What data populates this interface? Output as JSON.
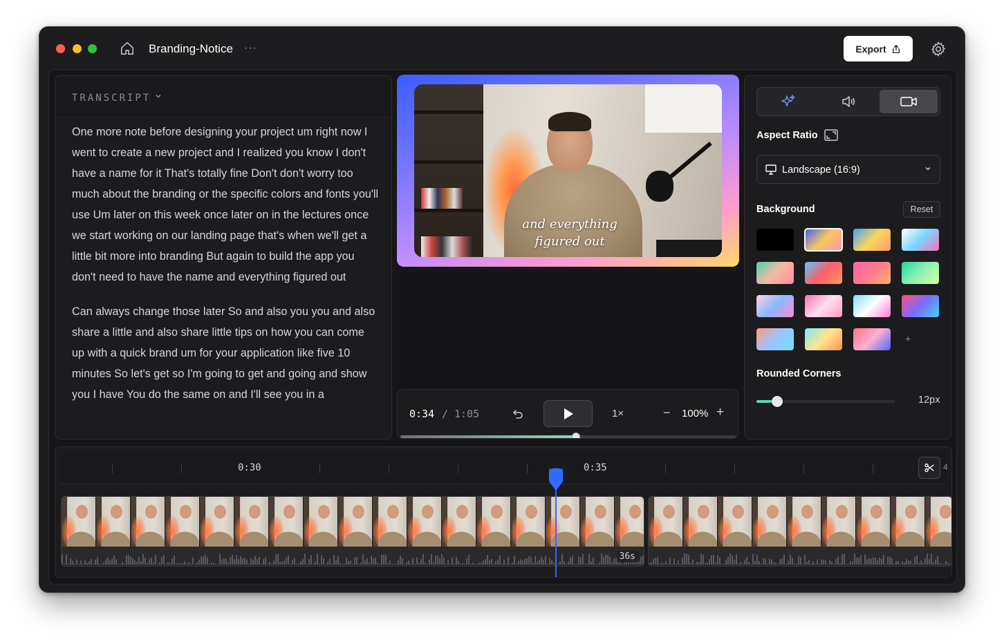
{
  "window": {
    "project_title": "Branding-Notice",
    "more_label": "···",
    "export_label": "Export"
  },
  "transcript": {
    "header": "TRANSCRIPT",
    "paragraphs": [
      "One more note before designing your project um right now I went to create a new project and I realized you know I don't have a name for it That's totally fine Don't don't worry too much about the branding or the specific colors and fonts you'll use Um later on this week once later on in the lectures once we start working on our landing page that's when we'll get a little bit more into branding But again to build the app you don't need to have the name and everything figured out",
      "Can always change those later So and also you you and also share a little and also share little tips on how you can come up with a quick brand um for your application like five 10 minutes So let's get so I'm going to get and going and show you I have You do the same on and I'll see you in a"
    ]
  },
  "preview": {
    "caption_line1": "and everything",
    "caption_line2": "figured out"
  },
  "player": {
    "current_time": "0:34",
    "separator": "/",
    "total_time": "1:05",
    "speed": "1×",
    "zoom_minus": "−",
    "zoom": "100%",
    "zoom_plus": "+",
    "progress": 0.523
  },
  "settings": {
    "tabs": [
      {
        "name": "sparkle-icon",
        "active": false
      },
      {
        "name": "speaker-icon",
        "active": false
      },
      {
        "name": "camera-icon",
        "active": true
      }
    ],
    "aspect_ratio_label": "Aspect Ratio",
    "aspect_ratio_value": "Landscape (16:9)",
    "background_label": "Background",
    "reset_label": "Reset",
    "add_label": "+",
    "swatches": [
      {
        "colors": [
          "#000000",
          "#000000"
        ],
        "selected": false
      },
      {
        "colors": [
          "#3a5bff",
          "#f7c85a",
          "#ff8fb5"
        ],
        "selected": true
      },
      {
        "colors": [
          "#3fa3ff",
          "#f9d65a",
          "#ff9b6e"
        ],
        "selected": false
      },
      {
        "colors": [
          "#ffffff",
          "#7ad7ff",
          "#ff6fb6"
        ],
        "selected": false
      },
      {
        "colors": [
          "#4fd3b0",
          "#f6b9a2",
          "#ff8aa0"
        ],
        "selected": false
      },
      {
        "colors": [
          "#56c8ff",
          "#ff5d6c",
          "#ff9b5a"
        ],
        "selected": false
      },
      {
        "colors": [
          "#ff5fb0",
          "#ff7a8a",
          "#ffb36b"
        ],
        "selected": false
      },
      {
        "colors": [
          "#26d39b",
          "#8ff0b5",
          "#d0ff9e"
        ],
        "selected": false
      },
      {
        "colors": [
          "#ffd2e0",
          "#8ab8ff",
          "#ff8bd1"
        ],
        "selected": false
      },
      {
        "colors": [
          "#ff6fb0",
          "#ffe0f0",
          "#ff9bc2"
        ],
        "selected": false
      },
      {
        "colors": [
          "#7fe0ff",
          "#ffffff",
          "#ff7ad9"
        ],
        "selected": false
      },
      {
        "colors": [
          "#ff4f7a",
          "#7c6bff",
          "#3fd2ff"
        ],
        "selected": false
      },
      {
        "colors": [
          "#ff9b7a",
          "#9ac3ff",
          "#6ee2ff"
        ],
        "selected": false
      },
      {
        "colors": [
          "#7ce5ff",
          "#ffe58a",
          "#ff8f5a"
        ],
        "selected": false
      },
      {
        "colors": [
          "#ff6f8a",
          "#ffb0d0",
          "#4a6bff"
        ],
        "selected": false
      }
    ],
    "rounded_label": "Rounded Corners",
    "rounded_value": "12px",
    "rounded_fraction": 0.15
  },
  "timeline": {
    "label_1": "0:30",
    "label_2": "0:35",
    "edge_label": "4",
    "clip_duration": "36s"
  },
  "colors": {
    "accent_blue": "#2f6bff",
    "slider_accent": "#5ed4b2"
  }
}
